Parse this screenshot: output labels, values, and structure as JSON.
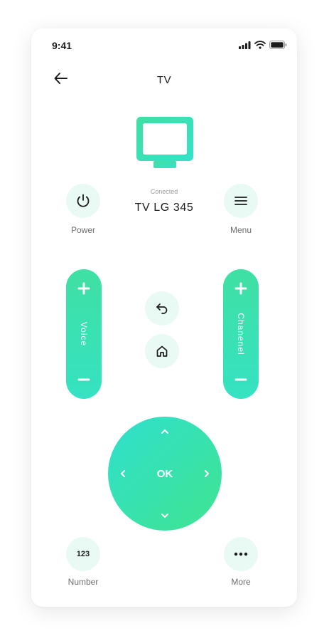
{
  "status_bar": {
    "time": "9:41"
  },
  "header": {
    "title": "TV"
  },
  "device": {
    "connected_label": "Conected",
    "name": "TV LG 345"
  },
  "buttons": {
    "power_label": "Power",
    "menu_label": "Menu",
    "number_label": "Number",
    "number_text": "123",
    "more_label": "More"
  },
  "volume": {
    "label": "Voice"
  },
  "channel": {
    "label": "Chanenel"
  },
  "dpad": {
    "ok_label": "OK"
  },
  "colors": {
    "accent": "#3fe0a3",
    "accent_alt": "#35e2c2",
    "button_bg": "#e9faf4",
    "text_dark": "#1c1c1c",
    "text_muted": "#6e6e6e"
  },
  "icons": {
    "back": "arrow-left-icon",
    "tv": "tv-icon",
    "power": "power-icon",
    "menu": "hamburger-icon",
    "return": "undo-icon",
    "home": "home-icon",
    "more": "dots-icon"
  }
}
